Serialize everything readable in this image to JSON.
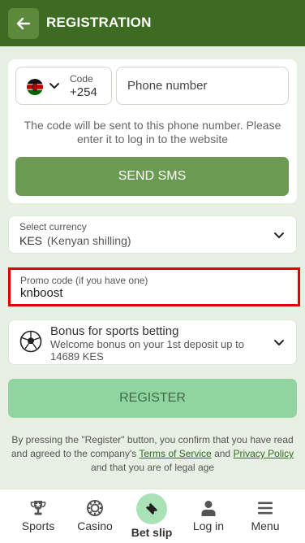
{
  "header": {
    "title": "REGISTRATION"
  },
  "phone": {
    "code_label": "Code",
    "code_value": "+254",
    "placeholder": "Phone number",
    "hint": "The code will be sent to this phone number. Please enter it to log in to the website",
    "send_label": "SEND SMS"
  },
  "currency": {
    "label": "Select currency",
    "code": "KES",
    "name": "(Kenyan shilling)"
  },
  "promo": {
    "label": "Promo code (if you have one)",
    "value": "knboost"
  },
  "bonus": {
    "title": "Bonus for sports betting",
    "description": "Welcome bonus on your 1st deposit up to 14689 KES"
  },
  "register_label": "REGISTER",
  "terms": {
    "part1": "By pressing the \"Register\" button, you confirm that you have read and agreed to the company's ",
    "link1": "Terms of Service",
    "part2": " and ",
    "link2": "Privacy Policy",
    "part3": " and that you are of legal age"
  },
  "nav": {
    "sports": "Sports",
    "casino": "Casino",
    "betslip": "Bet slip",
    "login": "Log in",
    "menu": "Menu"
  },
  "colors": {
    "header": "#3d6b22",
    "send_button": "#6b9b52",
    "register_button": "#90d4a0",
    "promo_highlight": "#e00000",
    "link": "#2f6b1f"
  },
  "icons": {
    "back": "arrow-left-icon",
    "flag": "kenya-flag-icon",
    "dropdown": "chevron-down-icon",
    "bonus": "soccer-ball-icon",
    "sports": "trophy-icon",
    "casino": "casino-chip-icon",
    "betslip": "ticket-icon",
    "login": "user-icon",
    "menu": "hamburger-icon"
  }
}
